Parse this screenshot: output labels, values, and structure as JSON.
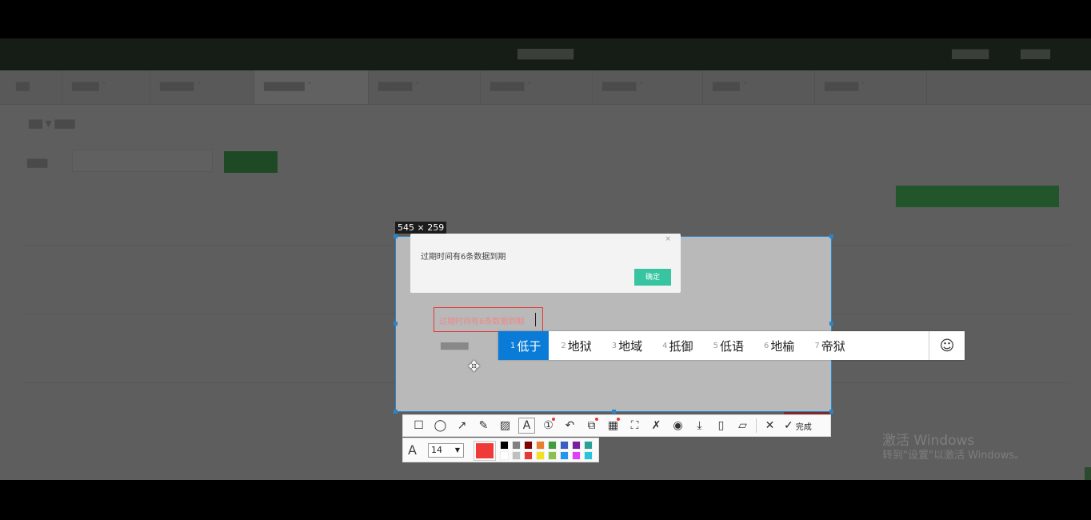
{
  "selection": {
    "dims_label": "545 × 259"
  },
  "dialog": {
    "message": "过期时间有6条数据到期",
    "ok_label": "确定",
    "close_glyph": "×"
  },
  "textbox": {
    "text": "过期时间有6条数据到期"
  },
  "ime": {
    "candidates": [
      {
        "num": "1",
        "text": "低于"
      },
      {
        "num": "2",
        "text": "地狱"
      },
      {
        "num": "3",
        "text": "地域"
      },
      {
        "num": "4",
        "text": "抵御"
      },
      {
        "num": "5",
        "text": "低语"
      },
      {
        "num": "6",
        "text": "地榆"
      },
      {
        "num": "7",
        "text": "帝狱"
      }
    ],
    "emoji_glyph": "☺"
  },
  "toolbar": {
    "tools": [
      {
        "name": "rectangle-tool",
        "glyph": "☐"
      },
      {
        "name": "ellipse-tool",
        "glyph": "◯"
      },
      {
        "name": "arrow-tool",
        "glyph": "↗"
      },
      {
        "name": "pen-tool",
        "glyph": "✎"
      },
      {
        "name": "mosaic-tool",
        "glyph": "▨"
      },
      {
        "name": "text-tool",
        "glyph": "A",
        "active": true
      },
      {
        "name": "number-tool",
        "glyph": "①",
        "dot": true
      },
      {
        "name": "undo-tool",
        "glyph": "↶"
      },
      {
        "name": "ocr-tool",
        "glyph": "⧉",
        "dot": true
      },
      {
        "name": "translate-tool",
        "glyph": "▦",
        "dot": true
      },
      {
        "name": "long-screenshot-tool",
        "glyph": "⛶"
      },
      {
        "name": "pin-tool",
        "glyph": "✗"
      },
      {
        "name": "record-tool",
        "glyph": "◉"
      },
      {
        "name": "download-tool",
        "glyph": "⤓"
      },
      {
        "name": "save-tool",
        "glyph": "▯"
      },
      {
        "name": "bookmark-tool",
        "glyph": "▱"
      }
    ],
    "cancel_glyph": "✕",
    "done_glyph": "✓",
    "done_label": "完成"
  },
  "style": {
    "font_glyph": "A",
    "font_size": "14",
    "current_color": "#f03a3a",
    "palette": [
      "#000000",
      "#808080",
      "#800000",
      "#e87f2e",
      "#3f9e3f",
      "#3a5fc4",
      "#7b1fa2",
      "#2aa198",
      "#ffffff",
      "#c0c0c0",
      "#e53935",
      "#f5e11b",
      "#8bc34a",
      "#2196f3",
      "#e040fb",
      "#26c6da"
    ]
  },
  "watermark": {
    "line1": "激活 Windows",
    "line2": "转到\"设置\"以激活 Windows。"
  },
  "colors": {
    "accent": "#2a84c8",
    "ime_selected": "#0a7bd6",
    "ok_button": "#36c5a0"
  }
}
